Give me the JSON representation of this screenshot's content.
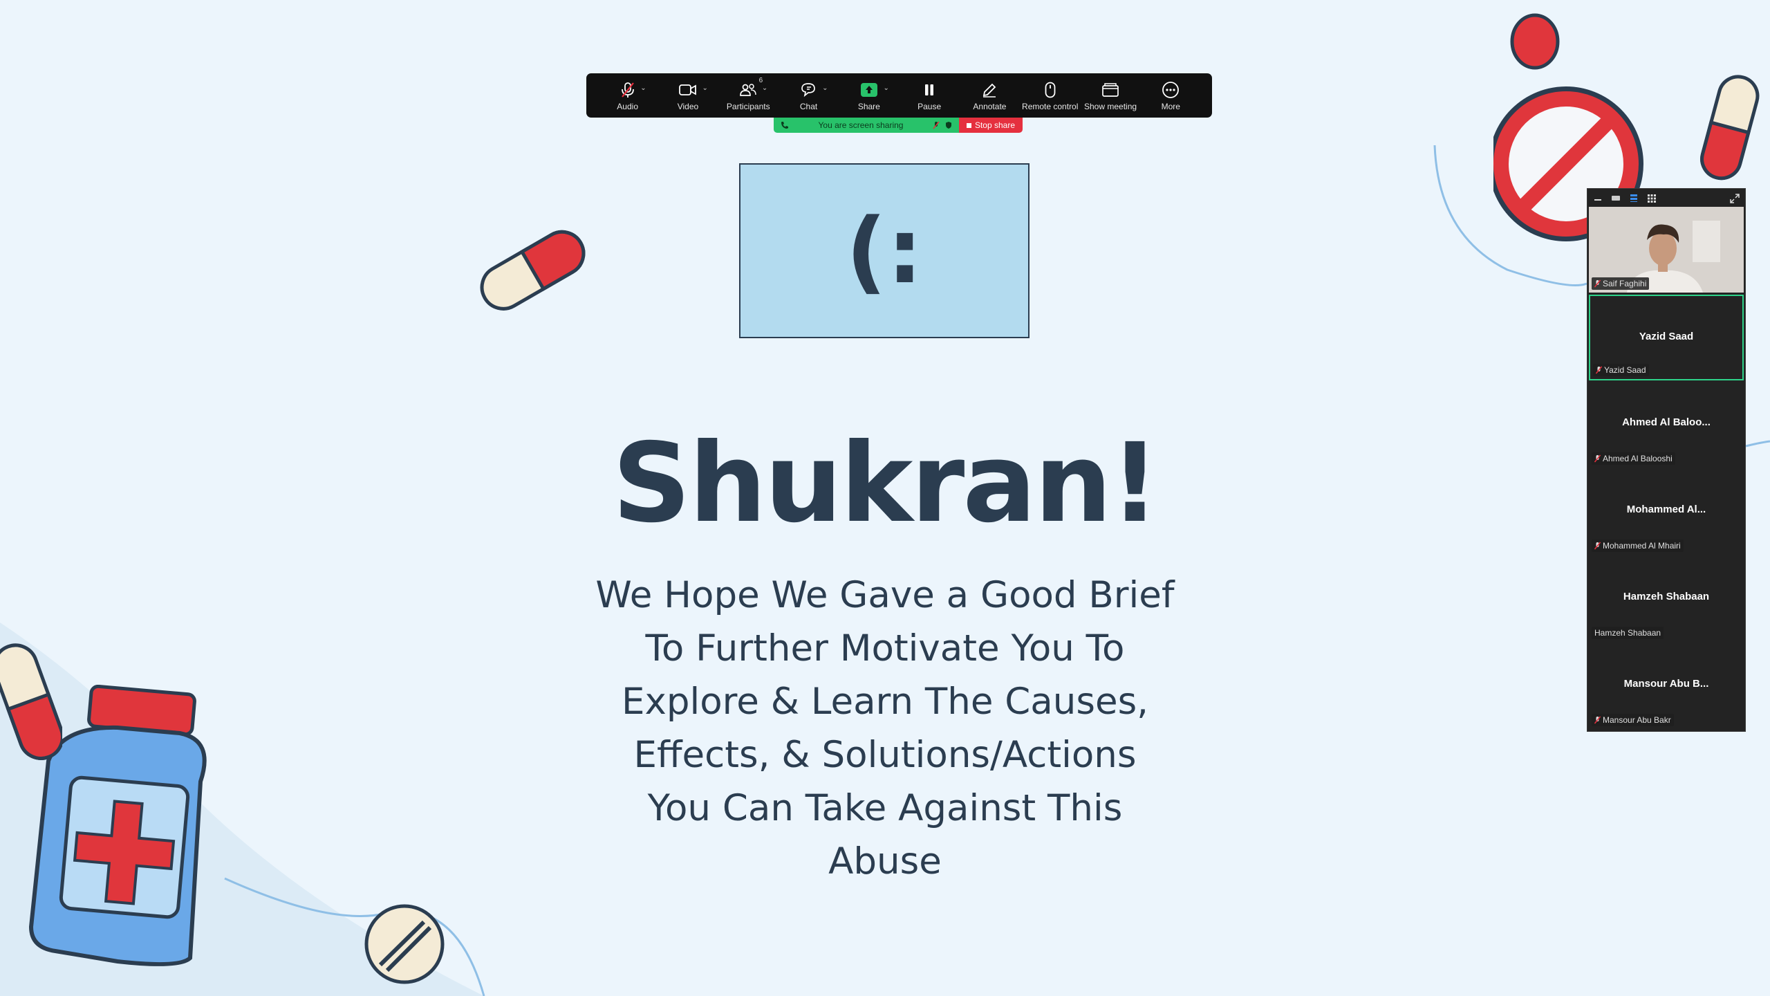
{
  "toolbar": {
    "buttons": [
      {
        "label": "Audio",
        "icon": "microphone-muted-icon",
        "has_menu": true
      },
      {
        "label": "Video",
        "icon": "video-camera-icon",
        "has_menu": true
      },
      {
        "label": "Participants",
        "icon": "participants-icon",
        "count": "6",
        "has_menu": true
      },
      {
        "label": "Chat",
        "icon": "chat-icon",
        "has_menu": true
      },
      {
        "label": "Share",
        "icon": "share-screen-icon",
        "has_menu": true
      },
      {
        "label": "Pause",
        "icon": "pause-icon"
      },
      {
        "label": "Annotate",
        "icon": "pencil-icon"
      },
      {
        "label": "Remote control",
        "icon": "mouse-icon"
      },
      {
        "label": "Show meeting",
        "icon": "window-icon"
      },
      {
        "label": "More",
        "icon": "more-icon"
      }
    ]
  },
  "share_banner": {
    "status": "You are screen sharing",
    "stop_label": "Stop share"
  },
  "slide": {
    "emoticon": "(:",
    "title": "Shukran!",
    "body_lines": [
      "We Hope We Gave a Good Brief",
      "To Further Motivate You To",
      "Explore & Learn The Causes,",
      "Effects, & Solutions/Actions",
      "You Can Take Against This",
      "Abuse"
    ]
  },
  "gallery": {
    "participants": [
      {
        "display": "",
        "name": "Saif Faghihi",
        "muted": true,
        "video": true
      },
      {
        "display": "Yazid Saad",
        "name": "Yazid Saad",
        "muted": true,
        "active": true
      },
      {
        "display": "Ahmed Al Baloo...",
        "name": "Ahmed Al Balooshi",
        "muted": true
      },
      {
        "display": "Mohammed Al...",
        "name": "Mohammed Al Mhairi",
        "muted": true
      },
      {
        "display": "Hamzeh Shabaan",
        "name": "Hamzeh Shabaan",
        "muted": false
      },
      {
        "display": "Mansour Abu B...",
        "name": "Mansour Abu Bakr",
        "muted": true
      }
    ]
  },
  "colors": {
    "slide_background": "#ecf5fc",
    "title_text": "#2b3d50",
    "banner_green": "#28c26a",
    "stop_red": "#e5303e",
    "active_speaker": "#2ed38a"
  }
}
